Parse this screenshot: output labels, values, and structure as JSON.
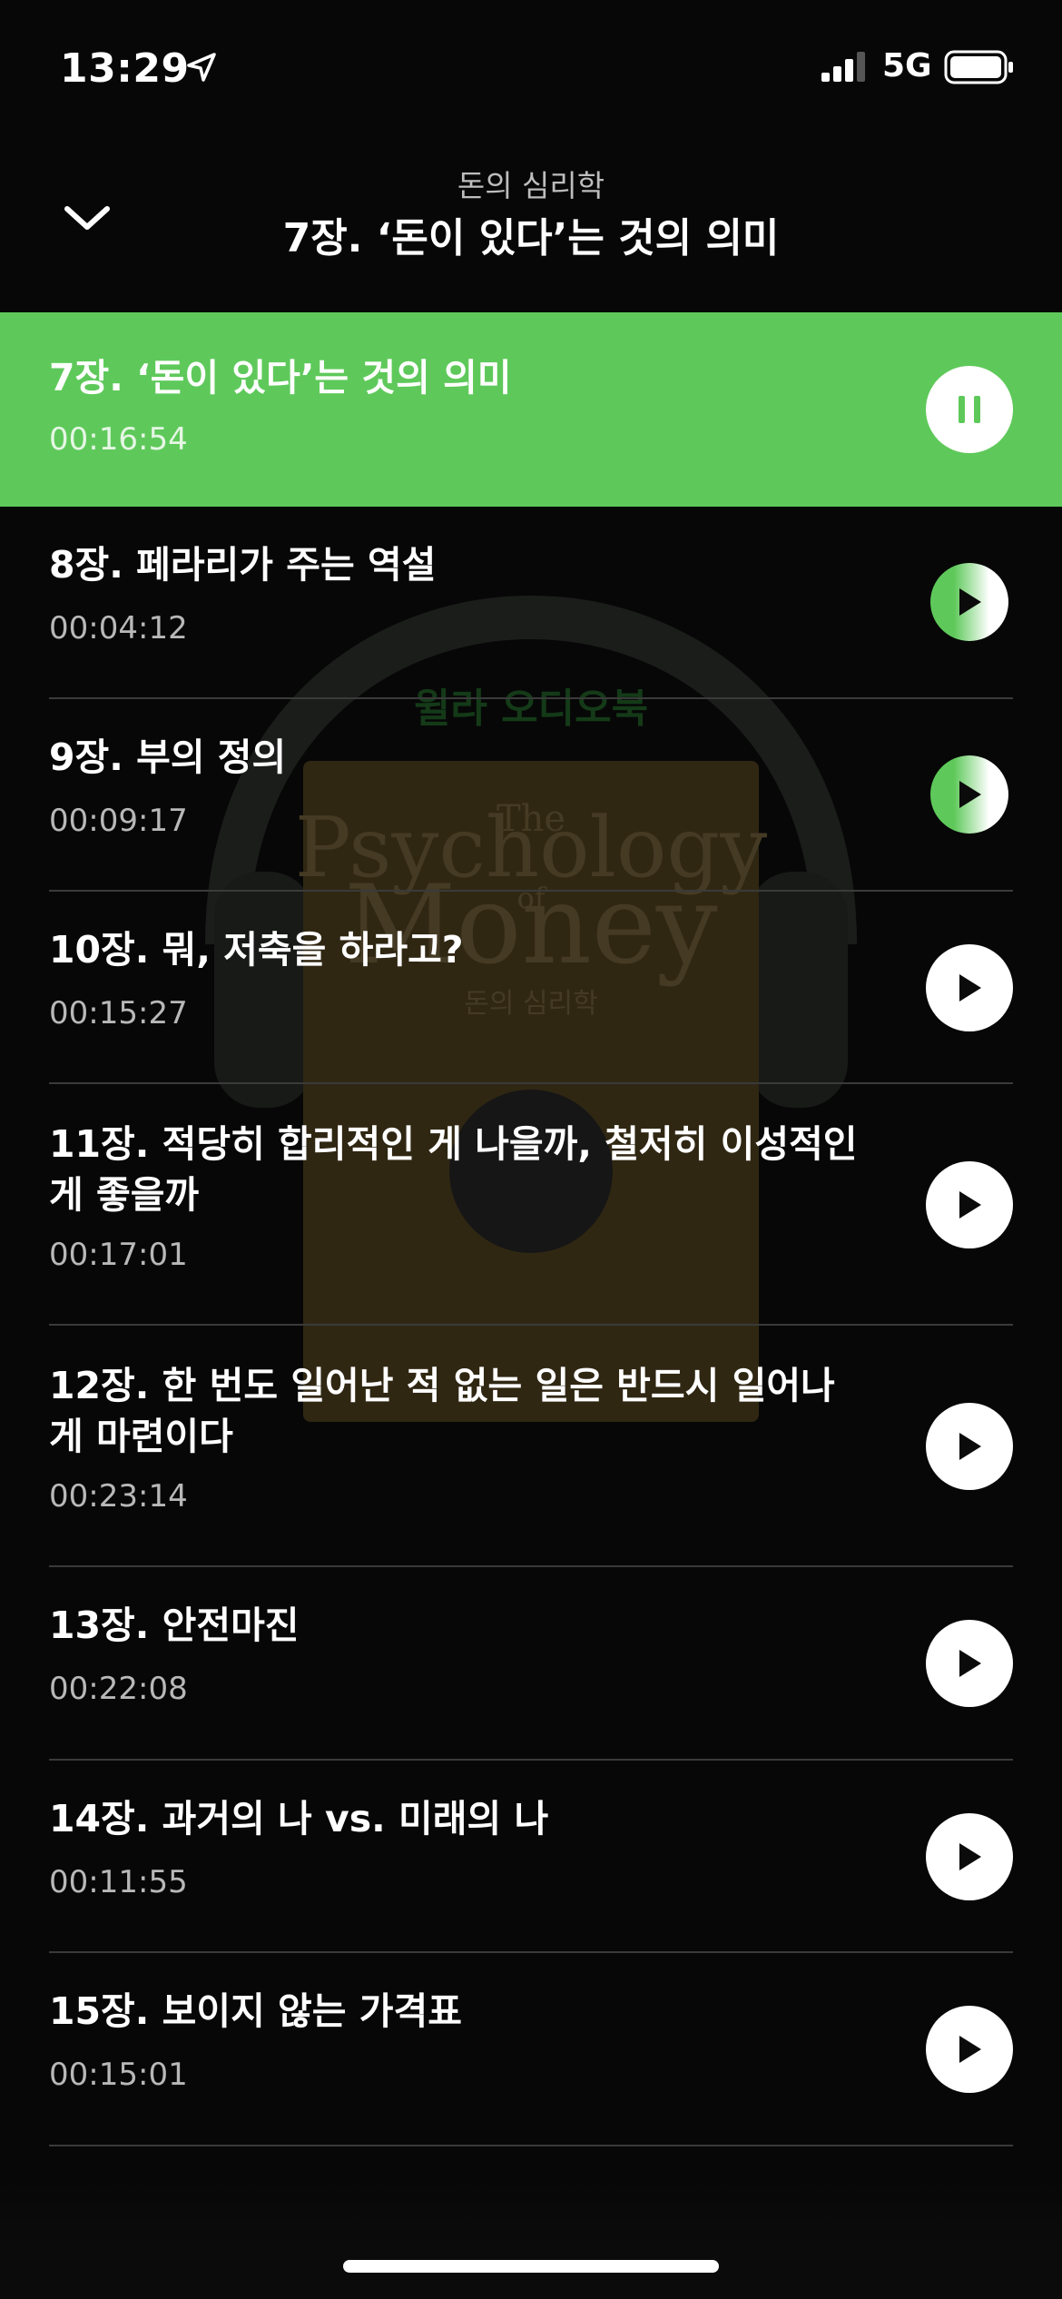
{
  "status": {
    "time": "13:29",
    "network": "5G"
  },
  "header": {
    "subtitle": "돈의 심리학",
    "title": "7장. ‘돈이 있다’는 것의 의미"
  },
  "cover": {
    "brand": "윌라 오디오북",
    "title_line1": "The",
    "title_line2": "Psychology",
    "title_line3": "of",
    "title_line4": "Money",
    "korean_title": "돈의 심리학"
  },
  "tracks": [
    {
      "title": "7장. ‘돈이 있다’는 것의 의미",
      "duration": "00:16:54",
      "state": "playing"
    },
    {
      "title": "8장. 페라리가 주는 역설",
      "duration": "00:04:12",
      "state": "partial"
    },
    {
      "title": "9장. 부의 정의",
      "duration": "00:09:17",
      "state": "partial"
    },
    {
      "title": "10장. 뭐, 저축을 하라고?",
      "duration": "00:15:27",
      "state": "idle"
    },
    {
      "title": "11장. 적당히 합리적인 게 나을까, 철저히 이성적인 게 좋을까",
      "duration": "00:17:01",
      "state": "idle"
    },
    {
      "title": "12장. 한 번도 일어난 적 없는 일은 반드시 일어나게 마련이다",
      "duration": "00:23:14",
      "state": "idle"
    },
    {
      "title": "13장. 안전마진",
      "duration": "00:22:08",
      "state": "idle"
    },
    {
      "title": "14장. 과거의 나 vs. 미래의 나",
      "duration": "00:11:55",
      "state": "idle"
    },
    {
      "title": "15장. 보이지 않는 가격표",
      "duration": "00:15:01",
      "state": "idle"
    }
  ],
  "colors": {
    "accent": "#5ec95a",
    "background": "#0b0b0b"
  }
}
